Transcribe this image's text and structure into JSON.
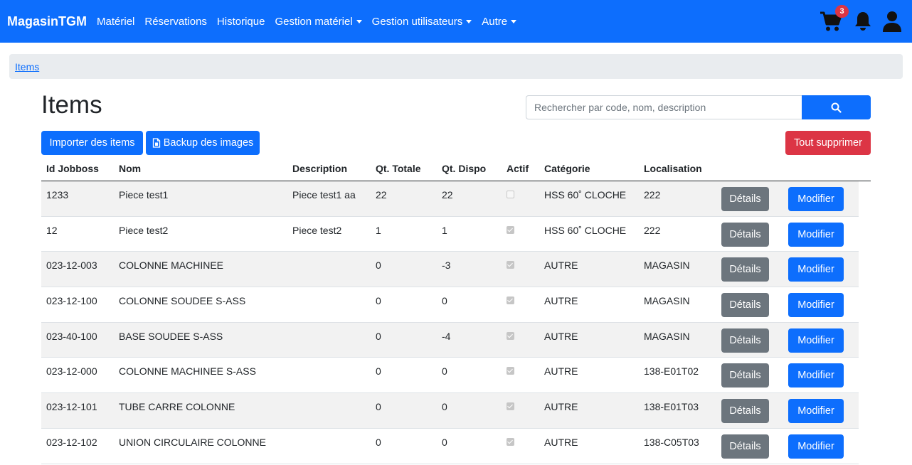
{
  "navbar": {
    "brand": "MagasinTGM",
    "items": [
      {
        "label": "Matériel",
        "dropdown": false
      },
      {
        "label": "Réservations",
        "dropdown": false
      },
      {
        "label": "Historique",
        "dropdown": false
      },
      {
        "label": "Gestion matériel",
        "dropdown": true
      },
      {
        "label": "Gestion utilisateurs",
        "dropdown": true
      },
      {
        "label": "Autre",
        "dropdown": true
      }
    ],
    "cart_count": "3",
    "icons": [
      "cart-icon",
      "bell-icon",
      "user-icon"
    ],
    "color": "#0d6efd"
  },
  "breadcrumb": {
    "current": "Items"
  },
  "page": {
    "title": "Items",
    "search_placeholder": "Rechercher par code, nom, description",
    "search_value": "",
    "import_label": "Importer des items",
    "backup_label": "Backup des images",
    "delete_all_label": "Tout supprimer"
  },
  "table": {
    "headers": {
      "id": "Id Jobboss",
      "name": "Nom",
      "description": "Description",
      "qty_total": "Qt. Totale",
      "qty_available": "Qt. Dispo",
      "active": "Actif",
      "category": "Catégorie",
      "location": "Localisation"
    },
    "details_label": "Détails",
    "edit_label": "Modifier",
    "rows": [
      {
        "id": "1233",
        "name": "Piece test1",
        "description": "Piece test1 aa",
        "qty_total": "22",
        "qty_available": "22",
        "active": false,
        "category": "HSS 60˚ CLOCHE",
        "location": "222",
        "details": "Détails",
        "edit": "Modifier"
      },
      {
        "id": "12",
        "name": "Piece test2",
        "description": "Piece test2",
        "qty_total": "1",
        "qty_available": "1",
        "active": true,
        "category": "HSS 60˚ CLOCHE",
        "location": "222",
        "details": "Détails",
        "edit": "Modifier"
      },
      {
        "id": "023-12-003",
        "name": "COLONNE MACHINEE",
        "description": "",
        "qty_total": "0",
        "qty_available": "-3",
        "active": true,
        "category": "AUTRE",
        "location": "MAGASIN",
        "details": "Détails",
        "edit": "Modifier"
      },
      {
        "id": "023-12-100",
        "name": "COLONNE SOUDEE S-ASS",
        "description": "",
        "qty_total": "0",
        "qty_available": "0",
        "active": true,
        "category": "AUTRE",
        "location": "MAGASIN",
        "details": "Détails",
        "edit": "Modifier"
      },
      {
        "id": "023-40-100",
        "name": "BASE SOUDEE S-ASS",
        "description": "",
        "qty_total": "0",
        "qty_available": "-4",
        "active": true,
        "category": "AUTRE",
        "location": "MAGASIN",
        "details": "Détails",
        "edit": "Modifier"
      },
      {
        "id": "023-12-000",
        "name": "COLONNE MACHINEE S-ASS",
        "description": "",
        "qty_total": "0",
        "qty_available": "0",
        "active": true,
        "category": "AUTRE",
        "location": "138-E01T02",
        "details": "Détails",
        "edit": "Modifier"
      },
      {
        "id": "023-12-101",
        "name": "TUBE CARRE COLONNE",
        "description": "",
        "qty_total": "0",
        "qty_available": "0",
        "active": true,
        "category": "AUTRE",
        "location": "138-E01T03",
        "details": "Détails",
        "edit": "Modifier"
      },
      {
        "id": "023-12-102",
        "name": "UNION CIRCULAIRE COLONNE",
        "description": "",
        "qty_total": "0",
        "qty_available": "0",
        "active": true,
        "category": "AUTRE",
        "location": "138-C05T03",
        "details": "Détails",
        "edit": "Modifier"
      }
    ]
  }
}
